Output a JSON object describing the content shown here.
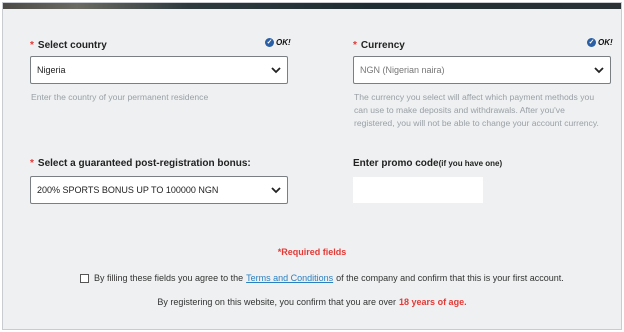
{
  "country": {
    "label": "Select country",
    "required_mark": "*",
    "ok_text": "OK!",
    "value": "Nigeria",
    "hint": "Enter the country of your permanent residence"
  },
  "currency": {
    "label": "Currency",
    "required_mark": "*",
    "ok_text": "OK!",
    "value": "NGN (Nigerian naira)",
    "hint_lines": [
      "The currency you select will affect which payment methods you",
      "can use to make deposits and withdrawals. After you've",
      "registered, you will not be able to change your account currency."
    ]
  },
  "bonus": {
    "label": "Select a guaranteed post-registration bonus:",
    "required_mark": "*",
    "value": "200% SPORTS BONUS UP TO 100000 NGN"
  },
  "promo": {
    "label": "Enter promo code",
    "label_small": "(if you have one)",
    "value": ""
  },
  "required_fields": "*Required fields",
  "agreement": {
    "prefix": "By filling these fields you agree to the",
    "link": "Terms and Conditions",
    "suffix": "of the company and confirm that this is your first account."
  },
  "age_notice": {
    "text": "By registering on this website, you confirm that you are over",
    "highlight": "18 years of age."
  },
  "colors": {
    "accent_red": "#e53935",
    "link_blue": "#2a7fc1",
    "ok_icon": "#2a5fa6"
  }
}
